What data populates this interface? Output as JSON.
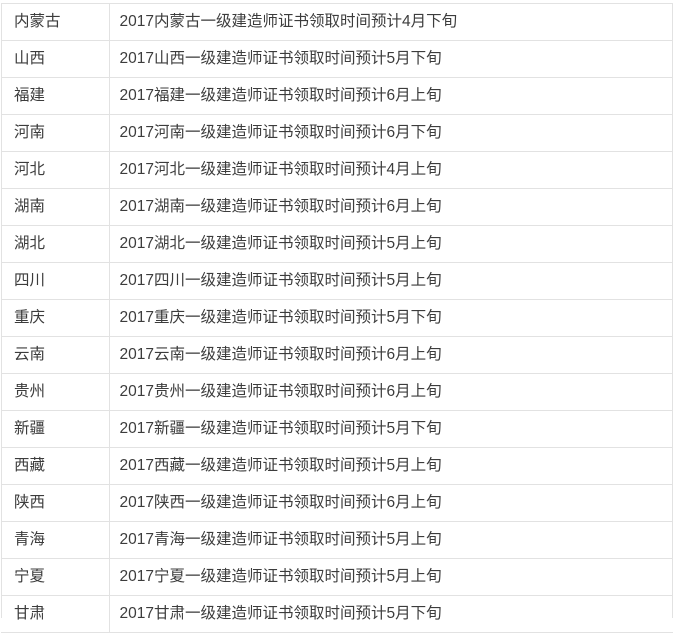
{
  "table": {
    "columns": [
      "province",
      "notice"
    ],
    "rows": [
      {
        "province": "内蒙古",
        "notice": "2017内蒙古一级建造师证书领取时间预计4月下旬"
      },
      {
        "province": "山西",
        "notice": "2017山西一级建造师证书领取时间预计5月下旬"
      },
      {
        "province": "福建",
        "notice": "2017福建一级建造师证书领取时间预计6月上旬"
      },
      {
        "province": "河南",
        "notice": "2017河南一级建造师证书领取时间预计6月下旬"
      },
      {
        "province": "河北",
        "notice": "2017河北一级建造师证书领取时间预计4月上旬"
      },
      {
        "province": "湖南",
        "notice": "2017湖南一级建造师证书领取时间预计6月上旬"
      },
      {
        "province": "湖北",
        "notice": "2017湖北一级建造师证书领取时间预计5月上旬"
      },
      {
        "province": "四川",
        "notice": "2017四川一级建造师证书领取时间预计5月上旬"
      },
      {
        "province": "重庆",
        "notice": "2017重庆一级建造师证书领取时间预计5月下旬"
      },
      {
        "province": "云南",
        "notice": "2017云南一级建造师证书领取时间预计6月上旬"
      },
      {
        "province": "贵州",
        "notice": "2017贵州一级建造师证书领取时间预计6月上旬"
      },
      {
        "province": "新疆",
        "notice": "2017新疆一级建造师证书领取时间预计5月下旬"
      },
      {
        "province": "西藏",
        "notice": "2017西藏一级建造师证书领取时间预计5月上旬"
      },
      {
        "province": "陕西",
        "notice": "2017陕西一级建造师证书领取时间预计6月上旬"
      },
      {
        "province": "青海",
        "notice": "2017青海一级建造师证书领取时间预计5月上旬"
      },
      {
        "province": "宁夏",
        "notice": "2017宁夏一级建造师证书领取时间预计5月上旬"
      },
      {
        "province": "甘肃",
        "notice": "2017甘肃一级建造师证书领取时间预计5月下旬"
      }
    ]
  },
  "style": {
    "border_color": "#e2e2e2",
    "text_color": "#3c3c3c",
    "background": "#ffffff"
  }
}
